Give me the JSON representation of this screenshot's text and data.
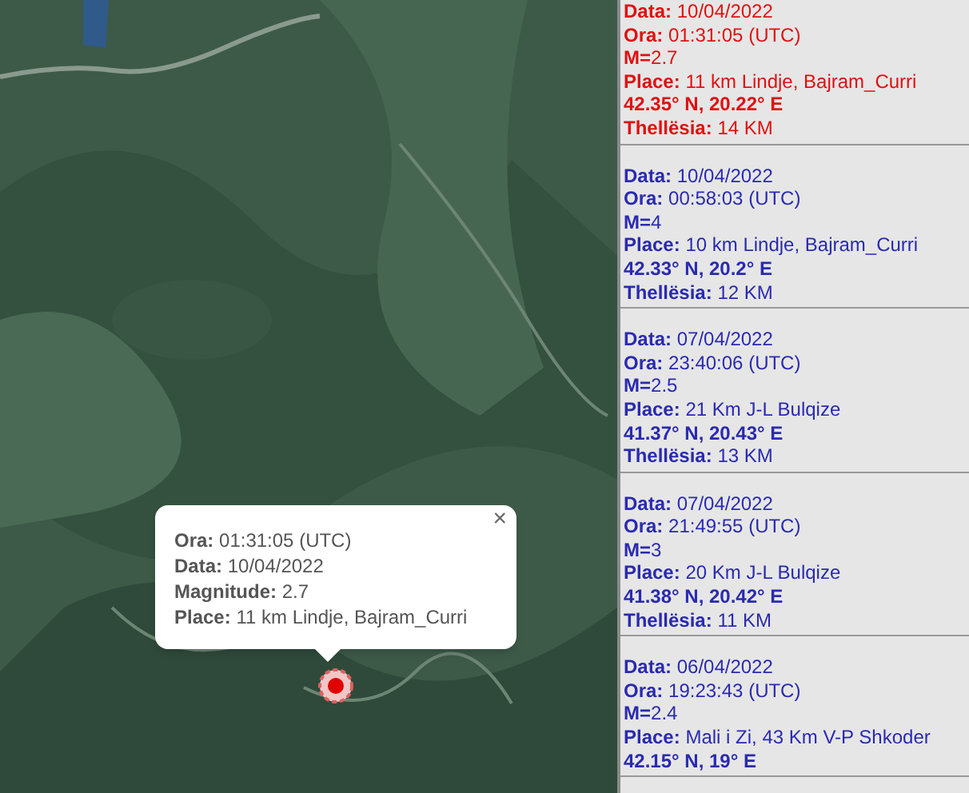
{
  "map": {
    "kind": "picture",
    "popup": {
      "close": "×",
      "lines": [
        {
          "text": "**Ora:** 01:31:05 (UTC)"
        },
        {
          "text": "**Data:** 10/04/2022"
        },
        {
          "text": "**Magnitude:** 2.7"
        },
        {
          "text": "**Place:** 11 km Lindje, Bajram_Curri"
        }
      ]
    }
  },
  "earthquakes": [
    {
      "selected": true,
      "lines": [
        {
          "kind": "field",
          "text": "**Data:** 10/04/2022"
        },
        {
          "kind": "field",
          "text": "**Ora:** 01:31:05 (UTC)"
        },
        {
          "kind": "field",
          "text": "**M=**2.7"
        },
        {
          "kind": "field",
          "text": "**Place:** 11 km Lindje, Bajram_Curri"
        },
        {
          "kind": "coords",
          "text": "42.35° N, 20.22° E"
        },
        {
          "kind": "field",
          "text": "**Thellësia:** 14 KM"
        }
      ]
    },
    {
      "selected": false,
      "lines": [
        {
          "kind": "field",
          "text": "**Data:** 10/04/2022"
        },
        {
          "kind": "field",
          "text": "**Ora:** 00:58:03 (UTC)"
        },
        {
          "kind": "field",
          "text": "**M=**4"
        },
        {
          "kind": "field",
          "text": "**Place:** 10 km Lindje, Bajram_Curri"
        },
        {
          "kind": "coords",
          "text": "42.33° N, 20.2° E"
        },
        {
          "kind": "field",
          "text": "**Thellësia:** 12 KM"
        }
      ]
    },
    {
      "selected": false,
      "lines": [
        {
          "kind": "field",
          "text": "**Data:** 07/04/2022"
        },
        {
          "kind": "field",
          "text": "**Ora:** 23:40:06 (UTC)"
        },
        {
          "kind": "field",
          "text": "**M=**2.5"
        },
        {
          "kind": "field",
          "text": "**Place:** 21 Km J-L Bulqize"
        },
        {
          "kind": "coords",
          "text": "41.37° N, 20.43° E"
        },
        {
          "kind": "field",
          "text": "**Thellësia:** 13 KM"
        }
      ]
    },
    {
      "selected": false,
      "lines": [
        {
          "kind": "field",
          "text": "**Data:** 07/04/2022"
        },
        {
          "kind": "field",
          "text": "**Ora:** 21:49:55 (UTC)"
        },
        {
          "kind": "field",
          "text": "**M=**3"
        },
        {
          "kind": "field",
          "text": "**Place:** 20 Km J-L Bulqize"
        },
        {
          "kind": "coords",
          "text": "41.38° N, 20.42° E"
        },
        {
          "kind": "field",
          "text": "**Thellësia:** 11 KM"
        }
      ]
    },
    {
      "selected": false,
      "lines": [
        {
          "kind": "field",
          "text": "**Data:** 06/04/2022"
        },
        {
          "kind": "field",
          "text": "**Ora:** 19:23:43 (UTC)"
        },
        {
          "kind": "field",
          "text": "**M=**2.4"
        },
        {
          "kind": "field",
          "text": "**Place:** Mali i Zi, 43 Km V-P Shkoder"
        },
        {
          "kind": "coords",
          "text": "42.15° N, 19° E"
        }
      ]
    }
  ]
}
